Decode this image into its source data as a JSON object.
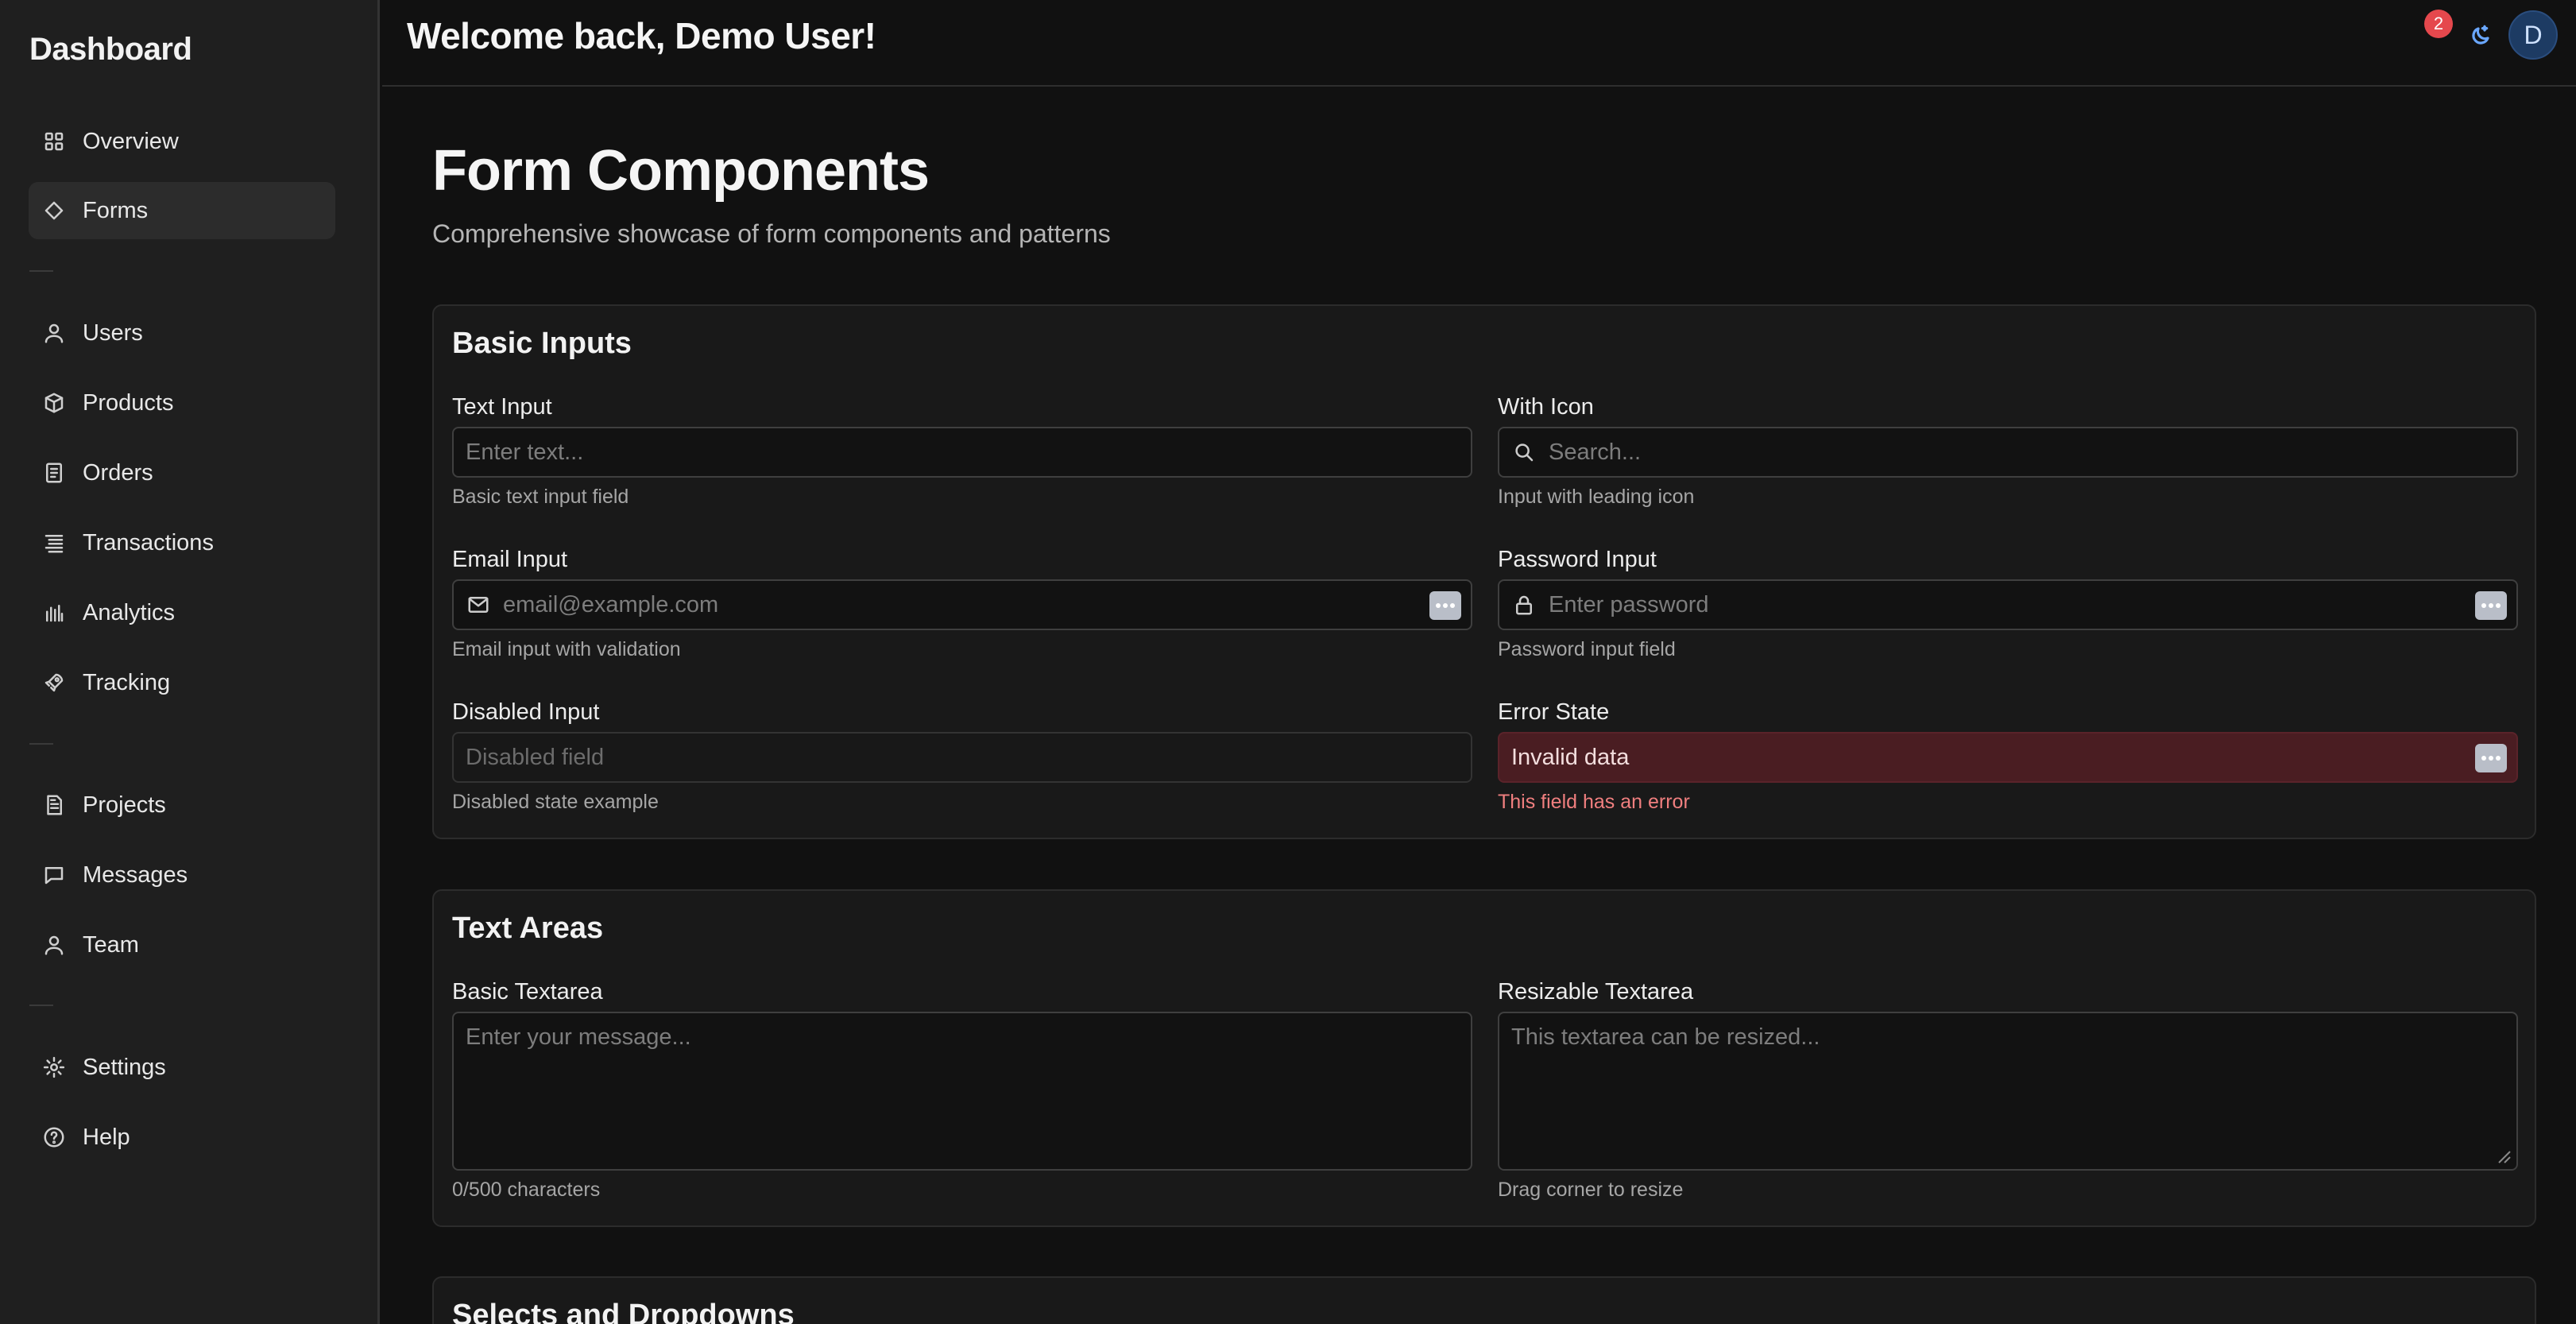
{
  "sidebar": {
    "brand": "Dashboard",
    "items": [
      {
        "label": "Overview",
        "icon": "grid-icon"
      },
      {
        "label": "Forms",
        "icon": "diamond-icon",
        "active": true
      },
      {
        "label": "Users",
        "icon": "user-icon"
      },
      {
        "label": "Products",
        "icon": "box-icon"
      },
      {
        "label": "Orders",
        "icon": "receipt-icon"
      },
      {
        "label": "Transactions",
        "icon": "list-icon"
      },
      {
        "label": "Analytics",
        "icon": "bar-chart-icon"
      },
      {
        "label": "Tracking",
        "icon": "rocket-icon"
      },
      {
        "label": "Projects",
        "icon": "document-icon"
      },
      {
        "label": "Messages",
        "icon": "message-icon"
      },
      {
        "label": "Team",
        "icon": "user-icon"
      },
      {
        "label": "Settings",
        "icon": "gear-icon"
      },
      {
        "label": "Help",
        "icon": "help-circle-icon"
      }
    ]
  },
  "header": {
    "welcome": "Welcome back, Demo User!",
    "notification_count": "2",
    "avatar_initial": "D"
  },
  "main": {
    "title": "Form Components",
    "subtitle": "Comprehensive showcase of form components and patterns",
    "basic_inputs": {
      "title": "Basic Inputs",
      "text_input": {
        "label": "Text Input",
        "placeholder": "Enter text...",
        "help": "Basic text input field"
      },
      "with_icon": {
        "label": "With Icon",
        "placeholder": "Search...",
        "help": "Input with leading icon"
      },
      "email_input": {
        "label": "Email Input",
        "placeholder": "email@example.com",
        "help": "Email input with validation"
      },
      "password_input": {
        "label": "Password Input",
        "placeholder": "Enter password",
        "help": "Password input field"
      },
      "disabled_input": {
        "label": "Disabled Input",
        "placeholder": "Disabled field",
        "help": "Disabled state example"
      },
      "error_state": {
        "label": "Error State",
        "value": "Invalid data",
        "help": "This field has an error"
      }
    },
    "text_areas": {
      "title": "Text Areas",
      "basic": {
        "label": "Basic Textarea",
        "placeholder": "Enter your message...",
        "help": "0/500 characters"
      },
      "resizable": {
        "label": "Resizable Textarea",
        "placeholder": "This textarea can be resized...",
        "help": "Drag corner to resize"
      }
    },
    "selects": {
      "title": "Selects and Dropdowns"
    }
  },
  "colors": {
    "background": "#111111",
    "sidebar": "#1f1f1f",
    "error_bg": "#4a1d22",
    "error_text": "#f07f7f",
    "badge": "#e5484d",
    "accent": "#6aa7ff"
  }
}
